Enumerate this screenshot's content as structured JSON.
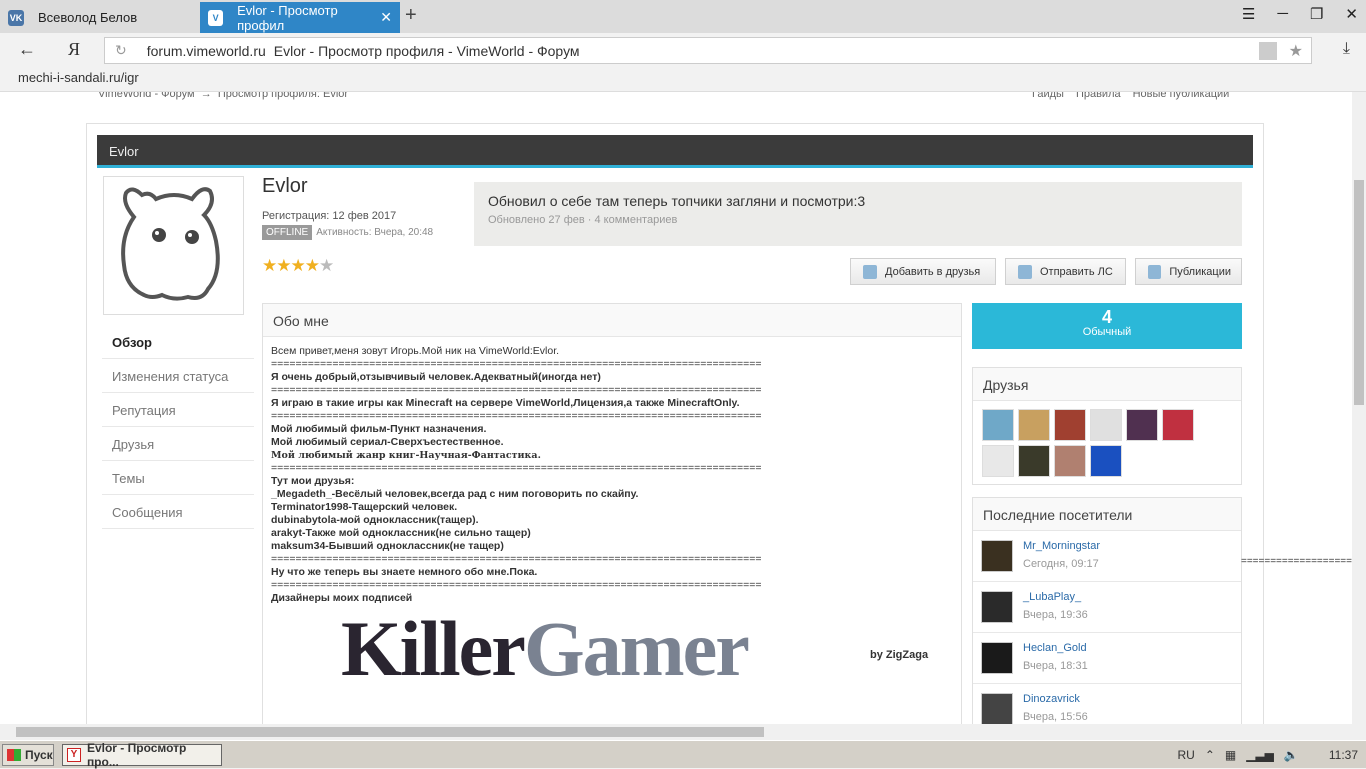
{
  "browser": {
    "tabs": [
      {
        "label": "Всеволод Белов",
        "icon": "vk-icon"
      },
      {
        "label": "Evlor - Просмотр профил",
        "icon": "vimeworld-icon"
      }
    ],
    "ya_label": "Я",
    "url_domain": "forum.vimeworld.ru",
    "url_title": "Evlor - Просмотр профиля - VimeWorld - Форум",
    "bookmark": "mechi-i-sandali.ru/igr"
  },
  "page": {
    "breadcrumb": [
      "VimeWorld - Форум",
      "→",
      "Просмотр профиля: Evlor"
    ],
    "toplinks": [
      "Гайды",
      "Правила",
      "Новые публикации"
    ],
    "title_bar": "Evlor",
    "profile": {
      "name": "Evlor",
      "registered": "Регистрация: 12 фев 2017",
      "offline_badge": "OFFLINE",
      "activity": "Активность: Вчера, 20:48",
      "rating": 4,
      "rating_max": 5
    },
    "status": {
      "text": "Обновил о себе там теперь топчики загляни и посмотри:3",
      "meta": "Обновлено 27 фев  · 4 комментариев"
    },
    "buttons": {
      "add_friend": "Добавить в друзья",
      "send_pm": "Отправить ЛС",
      "publications": "Публикации"
    },
    "nav": [
      "Обзор",
      "Изменения статуса",
      "Репутация",
      "Друзья",
      "Темы",
      "Сообщения"
    ],
    "about": {
      "header": "Обо мне",
      "line1": "Всем привет,меня зовут Игорь.Мой ник на VimeWorld:Evlor.",
      "sep": "================================================================================",
      "line2": "Я очень добрый,отзывчивый человек.Адекватный(иногда нет)",
      "line3": "Я играю в такие игры как Minecraft на сервере VimeWorld,Лицензия,а также MinecraftOnly.",
      "line4": "Мой любимый фильм-Пункт назначения.",
      "line5": "Мой любимый сериал-Сверхъестественное.",
      "line6": "Мой любимый жанр книг-Научная-Фантастика.",
      "friends_title": "Тут мои друзья:",
      "f1": "_Megadeth_-Весёлый человек,всегда рад с ним поговорить по скайпу.",
      "f2": "Terminator1998-Тащерский человек.",
      "f3": "dubinabytola-мой одноклассник(тащер).",
      "f4": "arakyt-Также мой одноклассник(не сильно тащер)",
      "f5": "maksum34-Бывший одноклассник(не тащер)",
      "line7": "Ну что же теперь вы знаете немного обо мне.Пока.",
      "line8": "Дизайнеры моих подписей",
      "logo_a": "Killer",
      "logo_b": "Gamer",
      "by": "by ZigZaga"
    },
    "reputation": {
      "value": "4",
      "label": "Обычный"
    },
    "friends_header": "Друзья",
    "friend_colors": [
      "#6fa8c8",
      "#c8a060",
      "#a04030",
      "#e0e0e0",
      "#503050",
      "#c03040",
      "#e8e8e8",
      "#3a3a2a",
      "#b08070",
      "#1a50c0"
    ],
    "visitors_header": "Последние посетители",
    "visitors": [
      {
        "name": "Mr_Morningstar",
        "time": "Сегодня, 09:17",
        "color": "#3a3020"
      },
      {
        "name": "_LubaPlay_",
        "time": "Вчера, 19:36",
        "color": "#2a2a2a"
      },
      {
        "name": "Heclan_Gold",
        "time": "Вчера, 18:31",
        "color": "#1a1a1a"
      },
      {
        "name": "Dinozavrick",
        "time": "Вчера, 15:56",
        "color": "#444"
      }
    ]
  },
  "taskbar": {
    "start": "Пуск",
    "task": "Evlor - Просмотр про...",
    "lang": "RU",
    "time": "11:37"
  }
}
